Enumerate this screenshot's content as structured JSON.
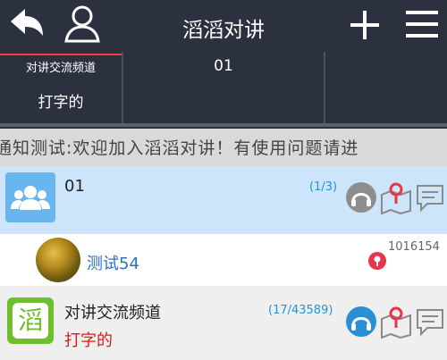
{
  "header": {
    "title": "滔滔对讲",
    "icons": [
      "back-arrow-icon",
      "user-icon",
      "plus-icon",
      "menu-icon"
    ]
  },
  "channel_strip": {
    "cell1_title": "对讲交流频道",
    "cell1_sub": "打字的",
    "cell2_value": "01"
  },
  "marquee": {
    "text": "通知测试:欢迎加入滔滔对讲！有使用问题请进"
  },
  "list": {
    "group": {
      "name": "01",
      "count": "(1/3)"
    },
    "member": {
      "name": "测试54",
      "id": "1016154"
    },
    "channel": {
      "name": "对讲交流频道",
      "status": "打字的",
      "count": "(17/43589)"
    },
    "brand_glyph": "滔"
  },
  "colors": {
    "header_bg": "#2c3140",
    "accent_blue": "#2196d3",
    "alert_red": "#e8354a",
    "highlight_row": "#cce5fb",
    "brand_green": "#6fbe2b"
  }
}
